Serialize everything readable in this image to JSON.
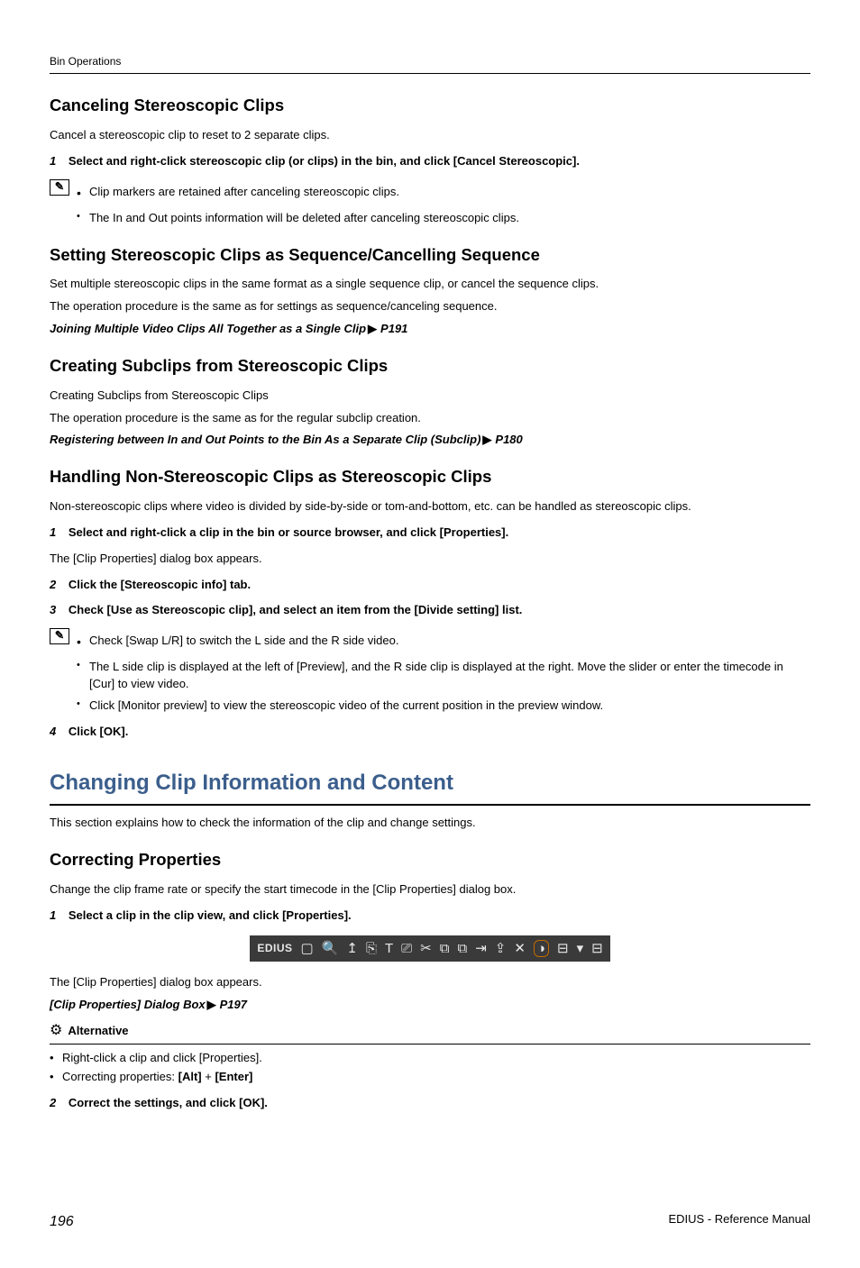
{
  "header": "Bin Operations",
  "s1": {
    "title": "Canceling Stereoscopic Clips",
    "intro": "Cancel a stereoscopic clip to reset to 2 separate clips.",
    "step1": "Select and right-click stereoscopic clip (or clips) in the bin, and click [Cancel Stereoscopic].",
    "note1": "Clip markers are retained after canceling stereoscopic clips.",
    "note2": "The In and Out points information will be deleted after canceling stereoscopic clips."
  },
  "s2": {
    "title": "Setting Stereoscopic Clips as Sequence/Cancelling Sequence",
    "p1": "Set multiple stereoscopic clips in the same format as a single sequence clip, or cancel the sequence clips.",
    "p2": "The operation procedure is the same as for settings as sequence/canceling sequence.",
    "xref": "Joining Multiple Video Clips All Together as a Single Clip",
    "xref_page": "P191"
  },
  "s3": {
    "title": "Creating Subclips from Stereoscopic Clips",
    "p1": "Creating Subclips from Stereoscopic Clips",
    "p2": "The operation procedure is the same as for the regular subclip creation.",
    "xref": "Registering between In and Out Points to the Bin As a Separate Clip (Subclip)",
    "xref_page": "P180"
  },
  "s4": {
    "title": "Handling Non-Stereoscopic Clips as Stereoscopic Clips",
    "intro": "Non-stereoscopic clips where video is divided by side-by-side or tom-and-bottom, etc. can be handled as stereoscopic clips.",
    "step1": "Select and right-click a clip in the bin or source browser, and click [Properties].",
    "step1_after": "The [Clip Properties] dialog box appears.",
    "step2": "Click the [Stereoscopic info] tab.",
    "step3": "Check [Use as Stereoscopic clip], and select an item from the [Divide setting] list.",
    "note1": "Check [Swap L/R] to switch the L side and the R side video.",
    "note2": "The L side clip is displayed at the left of [Preview], and the R side clip is displayed at the right. Move the slider or enter the timecode in [Cur] to view video.",
    "note3": "Click [Monitor preview] to view the stereoscopic video of the current position in the preview window.",
    "step4": "Click [OK]."
  },
  "h1": "Changing Clip Information and Content",
  "h1_after": "This section explains how to check the information of the clip and change settings.",
  "s5": {
    "title": "Correcting Properties",
    "intro": "Change the clip frame rate or specify the start timecode in the [Clip Properties] dialog box.",
    "step1": "Select a clip in the clip view, and click [Properties].",
    "toolbar_label": "EDIUS",
    "after_toolbar": "The [Clip Properties] dialog box appears.",
    "xref": "[Clip Properties] Dialog Box",
    "xref_page": "P197",
    "alt_label": "Alternative",
    "alt1": "Right-click a clip and click [Properties].",
    "alt2_prefix": "Correcting properties: ",
    "alt2_k1": "[Alt]",
    "alt2_plus": " + ",
    "alt2_k2": "[Enter]",
    "step2": "Correct the settings, and click [OK]."
  },
  "footer": {
    "page": "196",
    "doc": "EDIUS - Reference Manual"
  }
}
